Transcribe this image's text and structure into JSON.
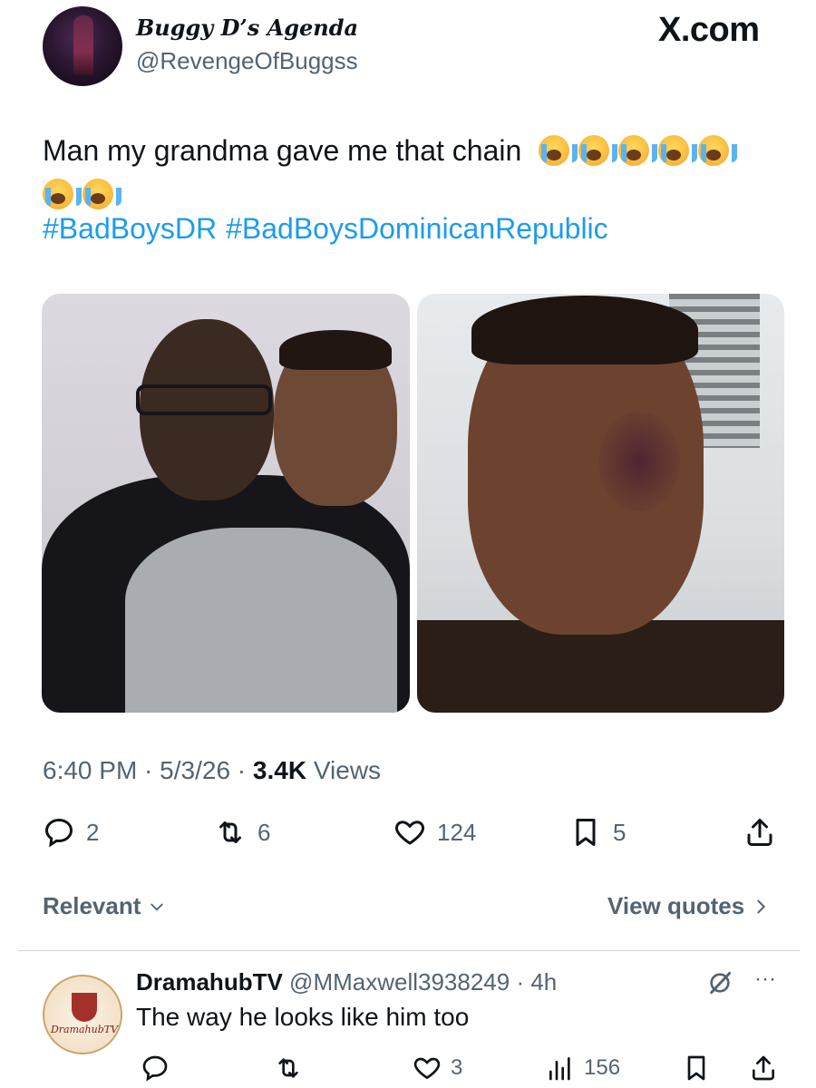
{
  "header": {
    "display_name": "Buggy D’s Agenda",
    "handle": "@RevengeOfBuggss",
    "brand": "X.com"
  },
  "tweet": {
    "text": "Man my grandma gave me that chain",
    "emoji": "loudly-crying-face",
    "emoji_count": 7,
    "hashtags": [
      "#BadBoysDR",
      "#BadBoysDominicanRepublic"
    ],
    "time": "6:40 PM",
    "date": "5/3/26",
    "views_count": "3.4K",
    "views_label": "Views"
  },
  "actions": {
    "replies": "2",
    "reposts": "6",
    "likes": "124",
    "bookmarks": "5"
  },
  "sort": {
    "relevant_label": "Relevant",
    "view_quotes_label": "View quotes"
  },
  "reply": {
    "name": "DramahubTV",
    "handle": "@MMaxwell3938249",
    "time": "4h",
    "text": "The way he looks like him too",
    "avatar_text": "DramahubTV",
    "likes": "3",
    "views": "156"
  },
  "colors": {
    "link": "#1d9bf0",
    "secondary_text": "#536471",
    "primary_text": "#0f1419"
  }
}
